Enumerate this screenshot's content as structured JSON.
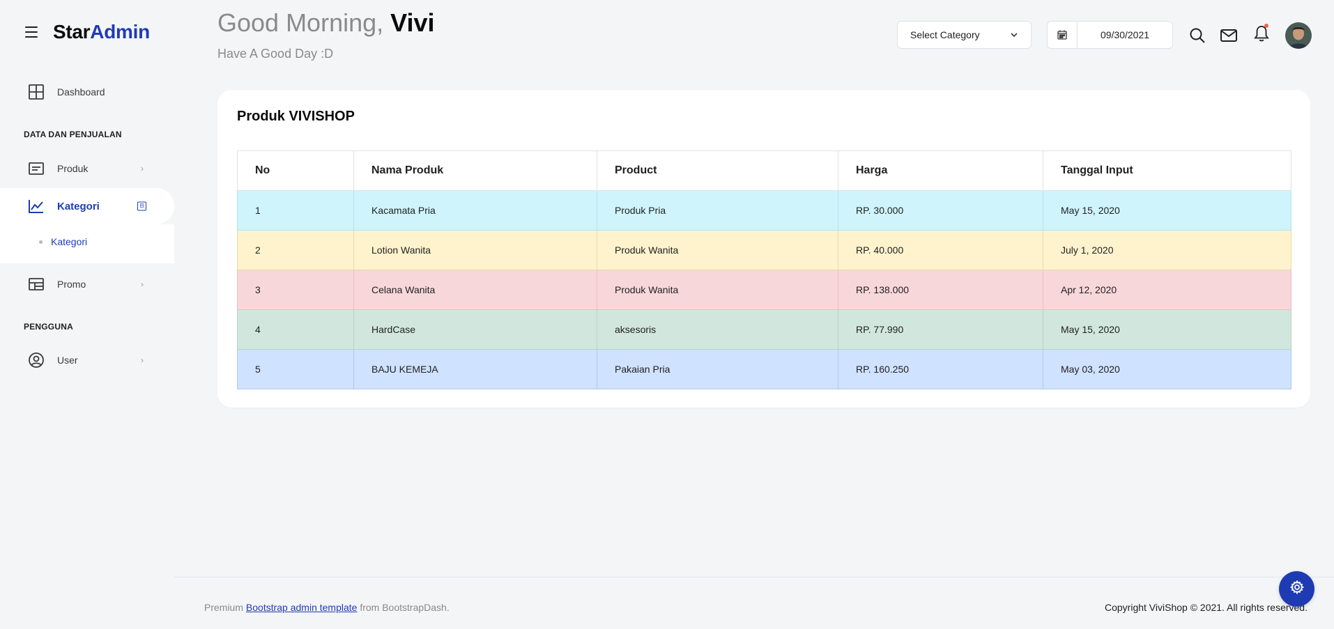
{
  "brand": {
    "part1": "Star",
    "part2": "Admin"
  },
  "sidebar": {
    "dashboard": "Dashboard",
    "section1": "DATA DAN PENJUALAN",
    "produk": "Produk",
    "kategori": "Kategori",
    "kategori_sub": "Kategori",
    "promo": "Promo",
    "section2": "PENGGUNA",
    "user": "User"
  },
  "header": {
    "greeting_prefix": "Good Morning, ",
    "greeting_name": "Vivi",
    "subtitle": "Have A Good Day :D",
    "select_category": "Select Category",
    "date_value": "09/30/2021"
  },
  "card": {
    "title": "Produk VIVISHOP",
    "columns": [
      "No",
      "Nama Produk",
      "Product",
      "Harga",
      "Tanggal Input"
    ],
    "rows": [
      [
        "1",
        "Kacamata Pria",
        "Produk Pria",
        "RP. 30.000",
        "May 15, 2020"
      ],
      [
        "2",
        "Lotion Wanita",
        "Produk Wanita",
        "RP. 40.000",
        "July 1, 2020"
      ],
      [
        "3",
        "Celana Wanita",
        "Produk Wanita",
        "RP. 138.000",
        "Apr 12, 2020"
      ],
      [
        "4",
        "HardCase",
        "aksesoris",
        "RP. 77.990",
        "May 15, 2020"
      ],
      [
        "5",
        "BAJU KEMEJA",
        "Pakaian Pria",
        "RP. 160.250",
        "May 03, 2020"
      ]
    ]
  },
  "footer": {
    "premium": "Premium ",
    "link": "Bootstrap admin template",
    "from": " from BootstrapDash.",
    "copyright": "Copyright ViviShop © 2021. All rights reserved."
  },
  "colors": {
    "accent": "#1F3BB3",
    "row_info": "#CFF4FC",
    "row_warning": "#FFF3CD",
    "row_danger": "#F8D7DA",
    "row_success": "#D1E7DD",
    "row_primary": "#CFE2FF"
  },
  "icons": [
    "menu-icon",
    "dashboard-grid-icon",
    "produk-list-icon",
    "chart-line-icon",
    "table-icon",
    "user-circle-icon",
    "chevron-right-icon",
    "calendar-icon",
    "search-icon",
    "mail-icon",
    "bell-icon",
    "gear-icon",
    "chevron-down-icon"
  ]
}
